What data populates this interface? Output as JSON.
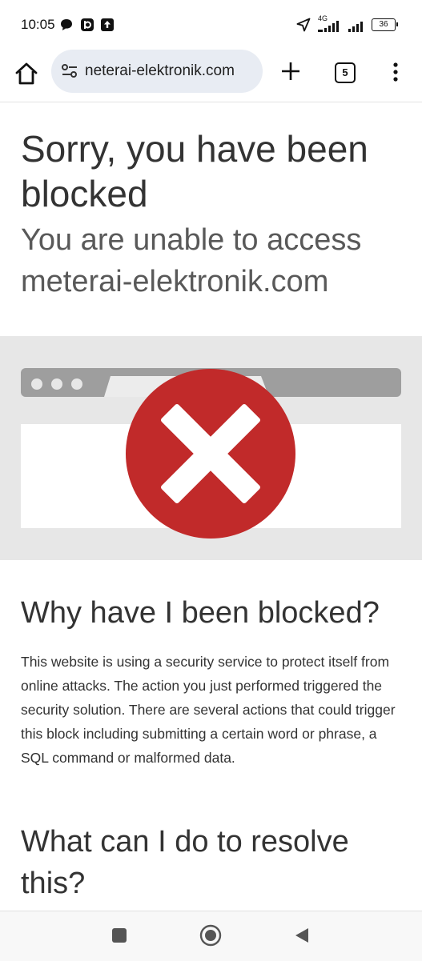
{
  "status_bar": {
    "time": "10:05",
    "network": "4G",
    "battery": "36"
  },
  "toolbar": {
    "url": "neterai-elektronik.com",
    "tab_count": "5"
  },
  "page": {
    "title": "Sorry, you have been blocked",
    "subtitle": "You are unable to access meterai-elektronik.com",
    "why_heading": "Why have I been blocked?",
    "why_text": "This website is using a security service to protect itself from online attacks. The action you just performed triggered the security solution. There are several actions that could trigger this block including submitting a certain word or phrase, a SQL command or malformed data.",
    "resolve_heading": "What can I do to resolve this?"
  },
  "colors": {
    "accent_red": "#c12a2a",
    "illustration_bg": "#e7e7e7",
    "url_pill": "#e8ecf3"
  }
}
